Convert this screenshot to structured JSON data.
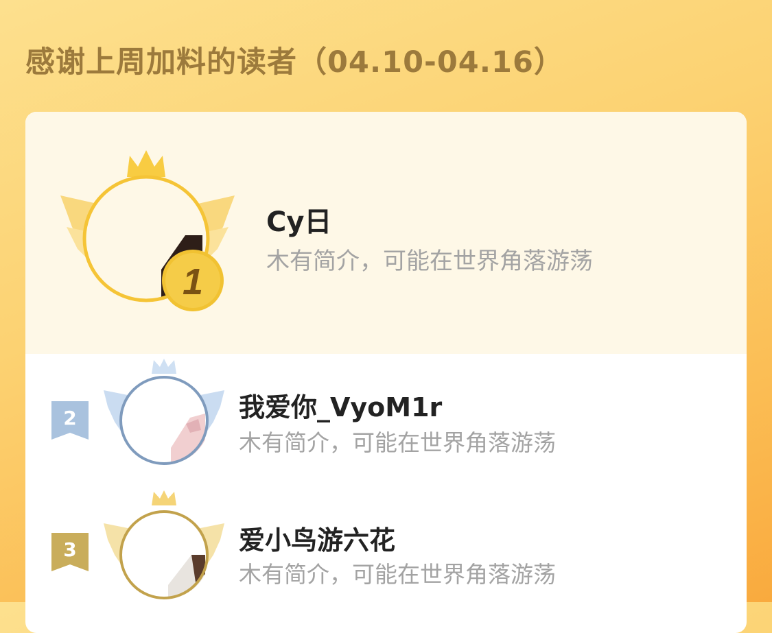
{
  "header": {
    "title": "感谢上周加料的读者（04.10-04.16）"
  },
  "readers": [
    {
      "rank": "1",
      "name": "Cy日",
      "bio": "木有简介，可能在世界角落游荡",
      "frame_color": "#f5c436",
      "badge_color": "#f1c232"
    },
    {
      "rank": "2",
      "name": "我爱你_VyoM1r",
      "bio": "木有简介，可能在世界角落游荡",
      "frame_color": "#7f9bbd",
      "badge_color": "#a9c2de"
    },
    {
      "rank": "3",
      "name": "爱小鸟游六花",
      "bio": "木有简介，可能在世界角落游荡",
      "frame_color": "#c2a24c",
      "badge_color": "#c9ad5b"
    }
  ]
}
